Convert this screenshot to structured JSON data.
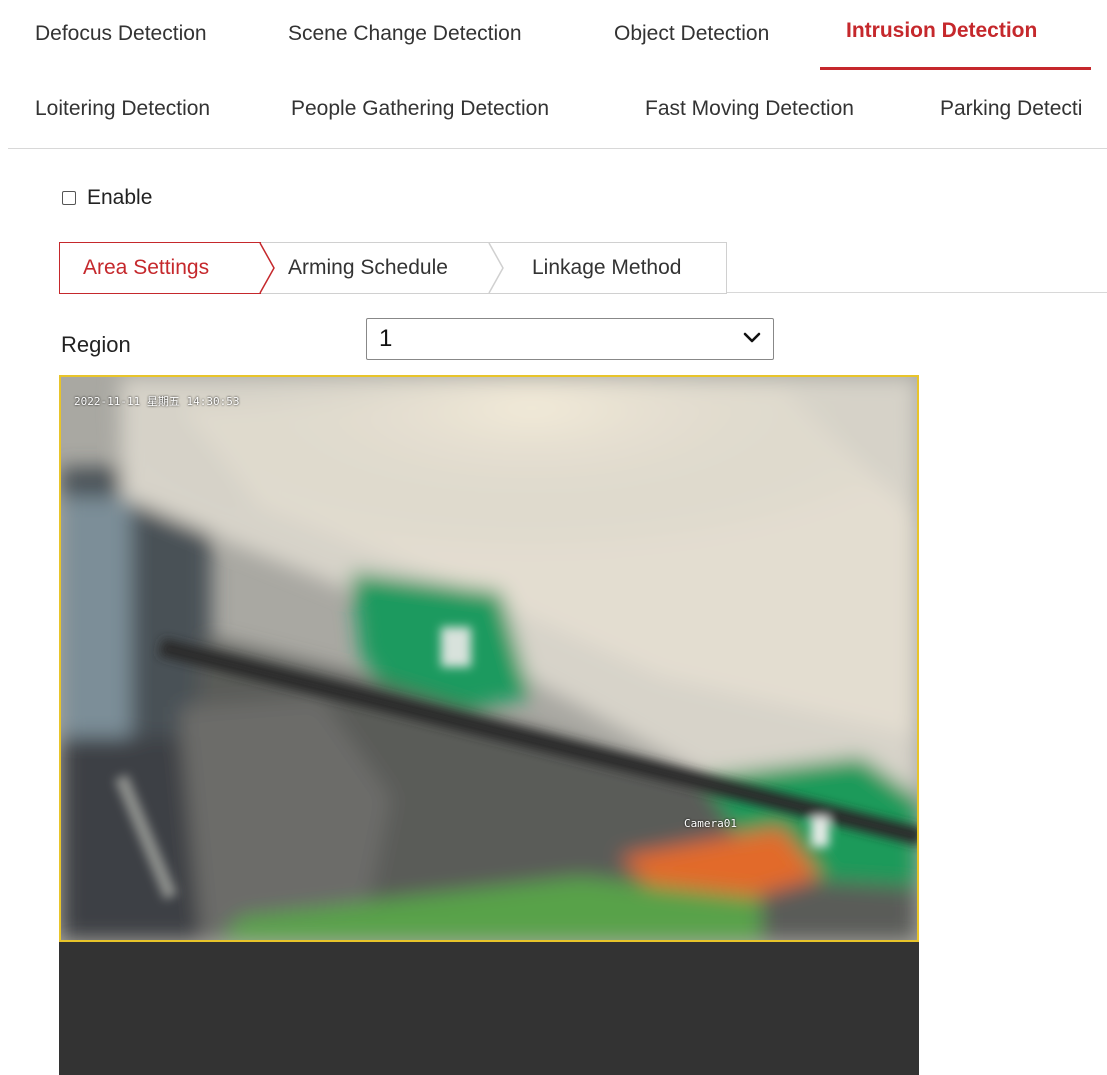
{
  "tabs_row1": [
    {
      "label": "Defocus Detection"
    },
    {
      "label": "Scene Change Detection"
    },
    {
      "label": "Object Detection"
    },
    {
      "label": "Intrusion Detection",
      "active": true
    }
  ],
  "tabs_row2": [
    {
      "label": "Loitering Detection"
    },
    {
      "label": "People Gathering Detection"
    },
    {
      "label": "Fast Moving Detection"
    },
    {
      "label": "Parking Detecti"
    }
  ],
  "enable": {
    "label": "Enable",
    "checked": false
  },
  "subtabs": [
    {
      "label": "Area Settings",
      "active": true
    },
    {
      "label": "Arming Schedule"
    },
    {
      "label": "Linkage Method"
    }
  ],
  "region": {
    "label": "Region",
    "value": "1"
  },
  "video": {
    "timestamp": "2022-11-11  星期五 14:30:53",
    "camera_name": "Camera01"
  },
  "colors": {
    "accent": "#c5282c",
    "video_border": "#e8c42a",
    "dark_panel": "#333333"
  },
  "icons": {
    "select_caret": "chevron-down-icon"
  }
}
